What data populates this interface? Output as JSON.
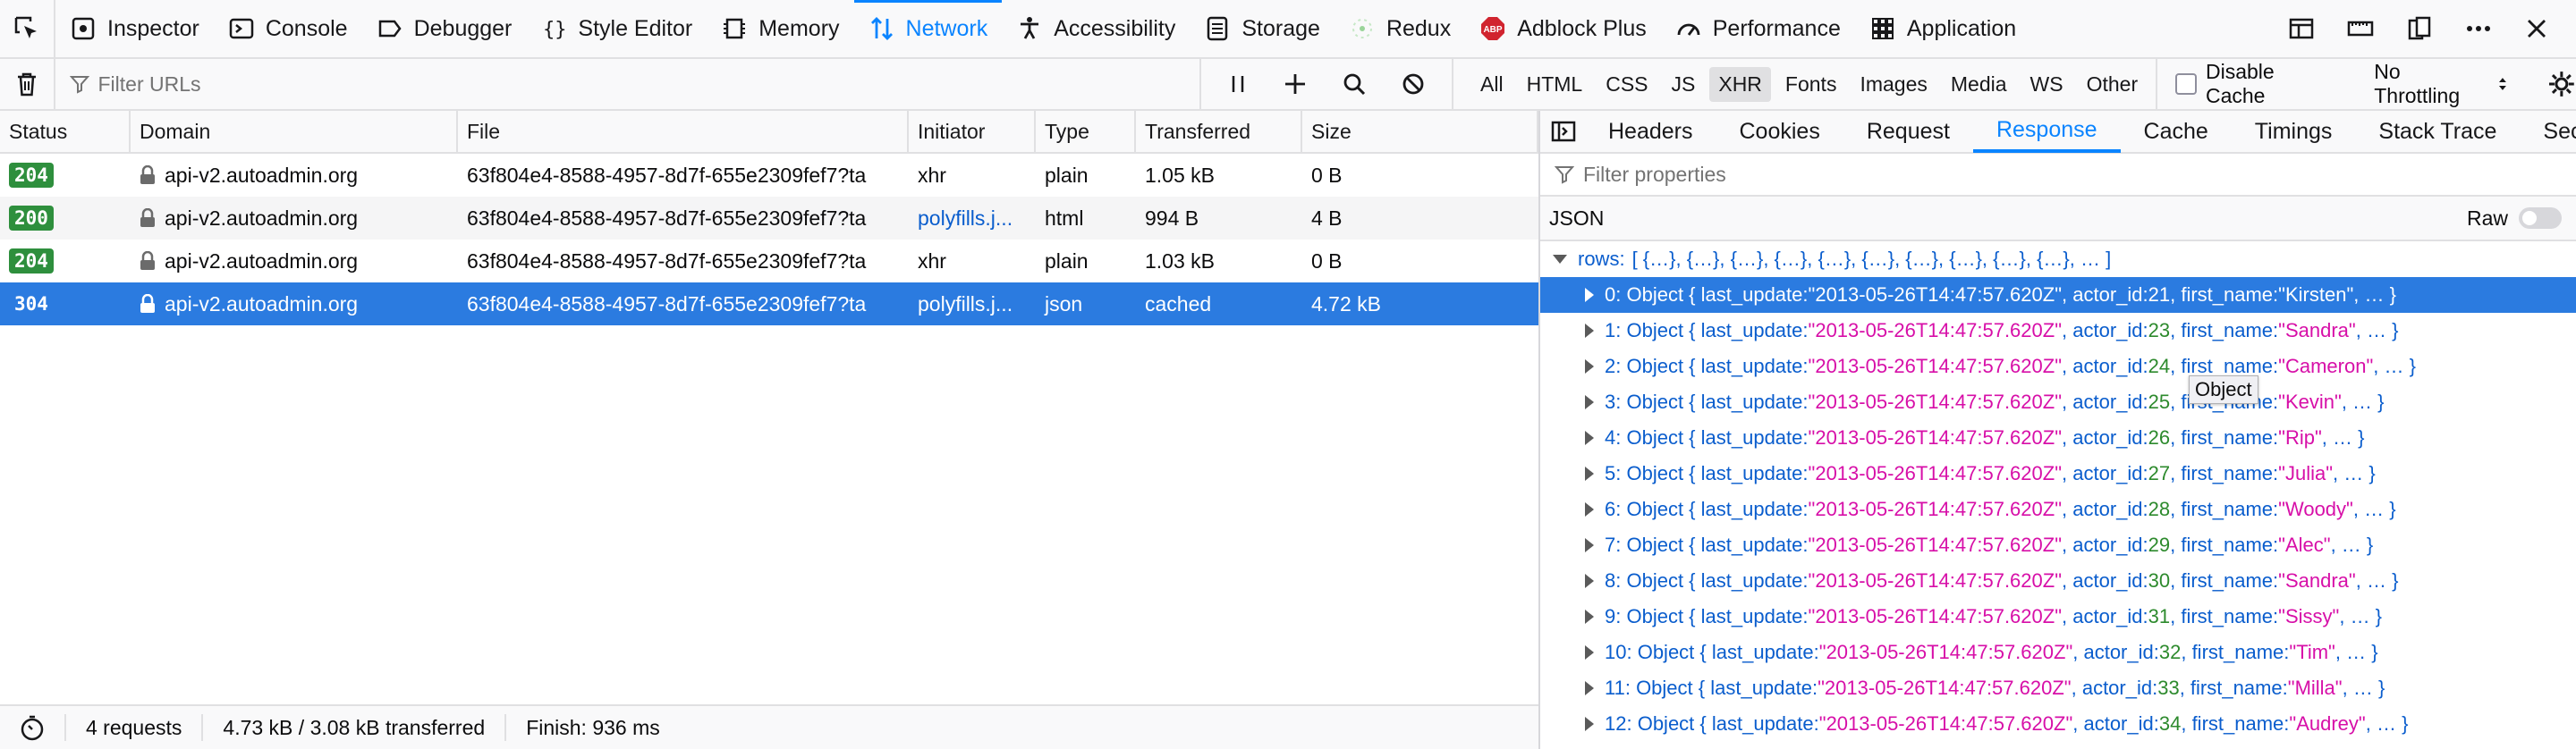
{
  "colors": {
    "accent": "#0a84ff",
    "selected_row": "#2b7be0",
    "status_ok": "#2e8f3d",
    "string": "#d70fa8",
    "number": "#2d8a2d"
  },
  "toolbar": {
    "tabs": [
      {
        "label": "Inspector",
        "icon": "inspector-icon"
      },
      {
        "label": "Console",
        "icon": "console-icon"
      },
      {
        "label": "Debugger",
        "icon": "debugger-icon"
      },
      {
        "label": "Style Editor",
        "icon": "style-editor-icon"
      },
      {
        "label": "Memory",
        "icon": "memory-icon"
      },
      {
        "label": "Network",
        "icon": "network-icon",
        "active": true
      },
      {
        "label": "Accessibility",
        "icon": "accessibility-icon"
      },
      {
        "label": "Storage",
        "icon": "storage-icon"
      },
      {
        "label": "Redux",
        "icon": "redux-icon"
      },
      {
        "label": "Adblock Plus",
        "icon": "adblock-icon",
        "icon_text": "ABP"
      },
      {
        "label": "Performance",
        "icon": "performance-icon"
      },
      {
        "label": "Application",
        "icon": "application-icon"
      }
    ]
  },
  "network_toolbar": {
    "filter_placeholder": "Filter URLs",
    "types": [
      "All",
      "HTML",
      "CSS",
      "JS",
      "XHR",
      "Fonts",
      "Images",
      "Media",
      "WS",
      "Other"
    ],
    "active_type": "XHR",
    "disable_cache_label": "Disable Cache",
    "throttling_label": "No Throttling"
  },
  "table": {
    "columns": [
      "Status",
      "Domain",
      "File",
      "Initiator",
      "Type",
      "Transferred",
      "Size"
    ],
    "rows": [
      {
        "status": "204",
        "domain": "api-v2.autoadmin.org",
        "file": "63f804e4-8588-4957-8d7f-655e2309fef7?ta",
        "initiator": "xhr",
        "type": "plain",
        "transferred": "1.05 kB",
        "size": "0 B"
      },
      {
        "status": "200",
        "domain": "api-v2.autoadmin.org",
        "file": "63f804e4-8588-4957-8d7f-655e2309fef7?ta",
        "initiator": "polyfills.j...",
        "type": "html",
        "transferred": "994 B",
        "size": "4 B"
      },
      {
        "status": "204",
        "domain": "api-v2.autoadmin.org",
        "file": "63f804e4-8588-4957-8d7f-655e2309fef7?ta",
        "initiator": "xhr",
        "type": "plain",
        "transferred": "1.03 kB",
        "size": "0 B"
      },
      {
        "status": "304",
        "domain": "api-v2.autoadmin.org",
        "file": "63f804e4-8588-4957-8d7f-655e2309fef7?ta",
        "initiator": "polyfills.j...",
        "type": "json",
        "transferred": "cached",
        "size": "4.72 kB",
        "selected": true
      }
    ]
  },
  "statusbar": {
    "requests": "4 requests",
    "transferred": "4.73 kB / 3.08 kB transferred",
    "finish": "Finish: 936 ms"
  },
  "details": {
    "tabs": [
      "Headers",
      "Cookies",
      "Request",
      "Response",
      "Cache",
      "Timings",
      "Stack Trace",
      "Secu"
    ],
    "active_tab": "Response",
    "filter_placeholder": "Filter properties",
    "json_label": "JSON",
    "raw_label": "Raw",
    "root": {
      "key": "rows:",
      "summary": "[ {…}, {…}, {…}, {…}, {…}, {…}, {…}, {…}, {…}, {…}, … ]"
    },
    "items": [
      {
        "index": "0",
        "last_update": "2013-05-26T14:47:57.620Z",
        "actor_id": "21",
        "first_name": "Kirsten",
        "selected": true
      },
      {
        "index": "1",
        "last_update": "2013-05-26T14:47:57.620Z",
        "actor_id": "23",
        "first_name": "Sandra"
      },
      {
        "index": "2",
        "last_update": "2013-05-26T14:47:57.620Z",
        "actor_id": "24",
        "first_name": "Cameron"
      },
      {
        "index": "3",
        "last_update": "2013-05-26T14:47:57.620Z",
        "actor_id": "25",
        "first_name": "Kevin"
      },
      {
        "index": "4",
        "last_update": "2013-05-26T14:47:57.620Z",
        "actor_id": "26",
        "first_name": "Rip"
      },
      {
        "index": "5",
        "last_update": "2013-05-26T14:47:57.620Z",
        "actor_id": "27",
        "first_name": "Julia"
      },
      {
        "index": "6",
        "last_update": "2013-05-26T14:47:57.620Z",
        "actor_id": "28",
        "first_name": "Woody"
      },
      {
        "index": "7",
        "last_update": "2013-05-26T14:47:57.620Z",
        "actor_id": "29",
        "first_name": "Alec"
      },
      {
        "index": "8",
        "last_update": "2013-05-26T14:47:57.620Z",
        "actor_id": "30",
        "first_name": "Sandra"
      },
      {
        "index": "9",
        "last_update": "2013-05-26T14:47:57.620Z",
        "actor_id": "31",
        "first_name": "Sissy"
      },
      {
        "index": "10",
        "last_update": "2013-05-26T14:47:57.620Z",
        "actor_id": "32",
        "first_name": "Tim"
      },
      {
        "index": "11",
        "last_update": "2013-05-26T14:47:57.620Z",
        "actor_id": "33",
        "first_name": "Milla"
      },
      {
        "index": "12",
        "last_update": "2013-05-26T14:47:57.620Z",
        "actor_id": "34",
        "first_name": "Audrey"
      }
    ],
    "tooltip": "Object"
  }
}
